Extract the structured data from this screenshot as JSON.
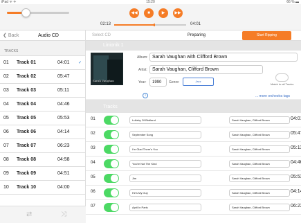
{
  "status": {
    "left": "iPad ᯤ ✈",
    "time": "15:20",
    "right": "66 % ▬"
  },
  "player": {
    "elapsed": "02:13",
    "remaining": "04:01",
    "volume": 0.3,
    "progress": 0.55
  },
  "left_nav": {
    "back_label": "Back",
    "title": "Audio CD",
    "section_label": "TRACKS"
  },
  "tracks": [
    {
      "num": "01",
      "title": "Track 01",
      "duration": "04:01",
      "checked": "✓"
    },
    {
      "num": "02",
      "title": "Track 02",
      "duration": "05:47",
      "checked": ""
    },
    {
      "num": "03",
      "title": "Track 03",
      "duration": "05:11",
      "checked": ""
    },
    {
      "num": "04",
      "title": "Track 04",
      "duration": "04:46",
      "checked": ""
    },
    {
      "num": "05",
      "title": "Track 05",
      "duration": "05:53",
      "checked": ""
    },
    {
      "num": "06",
      "title": "Track 06",
      "duration": "04:14",
      "checked": ""
    },
    {
      "num": "07",
      "title": "Track 07",
      "duration": "06:23",
      "checked": ""
    },
    {
      "num": "08",
      "title": "Track 08",
      "duration": "04:58",
      "checked": ""
    },
    {
      "num": "09",
      "title": "Track 09",
      "duration": "04:51",
      "checked": ""
    },
    {
      "num": "10",
      "title": "Track 10",
      "duration": "04:00",
      "checked": ""
    }
  ],
  "right_top": {
    "select_cd": "Select CD",
    "status": "Preparing",
    "rip_button": "Start Ripping"
  },
  "album_section": {
    "header": "Linionik 1"
  },
  "album": {
    "album_label": "Album:",
    "album_value": "Sarah Vaughan with Clifford Brown",
    "artist_label": "Artist:",
    "artist_value": "Sarah Vaughan, Clifford Brown",
    "year_label": "Year:",
    "year_value": "1990",
    "genre_label": "Genre:",
    "genre_value": "Jazz",
    "match_label": "Match to all Tracks",
    "more_tags": "... more orchestra tags",
    "cover_text": "Sarah Vaughan"
  },
  "tracks_section": {
    "header": "Tracks"
  },
  "rows": [
    {
      "num": "01",
      "title": "Lullaby Of Birdland",
      "artist": "Sarah Vaughan, Clifford Brown",
      "duration": "04:01"
    },
    {
      "num": "02",
      "title": "September Song",
      "artist": "Sarah Vaughan, Clifford Brown",
      "duration": "05:47"
    },
    {
      "num": "03",
      "title": "I'm Glad There's You",
      "artist": "Sarah Vaughan, Clifford Brown",
      "duration": "05:11"
    },
    {
      "num": "04",
      "title": "You're Not The Kind",
      "artist": "Sarah Vaughan, Clifford Brown",
      "duration": "04:46"
    },
    {
      "num": "05",
      "title": "Jim",
      "artist": "Sarah Vaughan, Clifford Brown",
      "duration": "05:53"
    },
    {
      "num": "06",
      "title": "He's My Guy",
      "artist": "Sarah Vaughan, Clifford Brown",
      "duration": "04:14"
    },
    {
      "num": "07",
      "title": "April In Paris",
      "artist": "Sarah Vaughan, Clifford Brown",
      "duration": "06:23"
    }
  ],
  "colors": {
    "accent": "#f57c26",
    "toggle_on": "#4cd964",
    "link": "#3a6fc6"
  }
}
